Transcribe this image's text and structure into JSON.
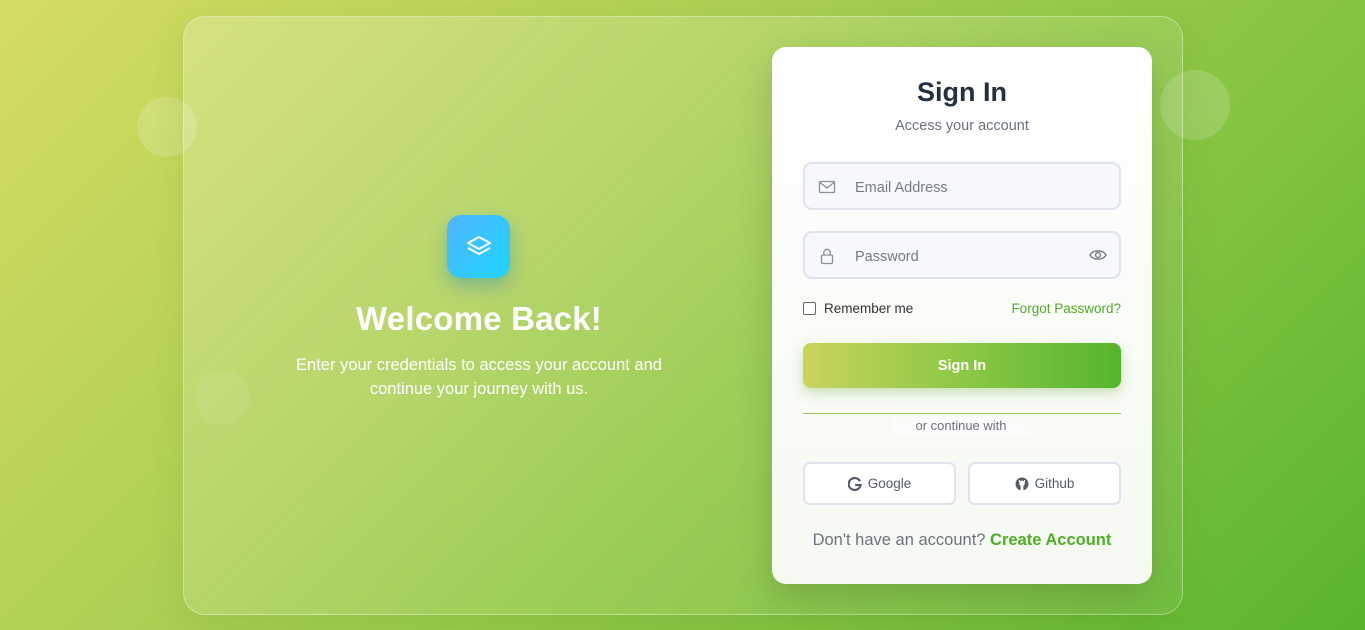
{
  "welcome": {
    "title": "Welcome Back!",
    "text": "Enter your credentials to access your account and continue your journey with us.",
    "logo_icon": "layers-icon"
  },
  "card": {
    "title": "Sign In",
    "subtitle": "Access your account",
    "email_placeholder": "Email Address",
    "password_placeholder": "Password",
    "remember_label": "Remember me",
    "forgot_label": "Forgot Password?",
    "signin_label": "Sign In",
    "divider_text": "or continue with",
    "google_label": "Google",
    "github_label": "Github",
    "footer_text": "Don't have an account?",
    "footer_link": "Create Account"
  },
  "colors": {
    "accent": "#4fae27",
    "title": "#233044",
    "logo_gradient": [
      "#4fb5ff",
      "#1fd4ff"
    ]
  }
}
